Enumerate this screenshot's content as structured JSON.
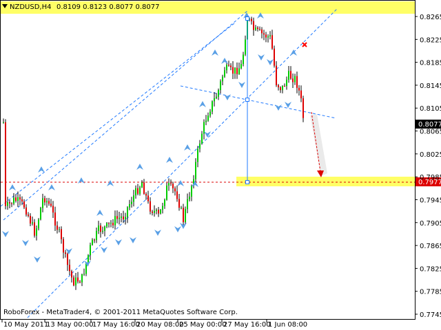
{
  "header": {
    "symbol": "NZDUSD,H4",
    "ohlc": "0.8109 0.8123 0.8077 0.8077"
  },
  "copyright": "RoboForex - MetaTrader4, © 2001-2011 MetaQuotes Software Corp.",
  "chart_data": {
    "type": "candlestick",
    "ylim": [
      0.7745,
      0.8285
    ],
    "grid": false,
    "y_ticks": [
      "0.8265",
      "0.8225",
      "0.8185",
      "0.8145",
      "0.8105",
      "0.8065",
      "0.8025",
      "0.7985",
      "0.7945",
      "0.7905",
      "0.7865",
      "0.7825",
      "0.7785",
      "0.7745"
    ],
    "x_ticks": [
      "10 May 2011",
      "13 May 00:00",
      "17 May 16:00",
      "20 May 08:00",
      "25 May 00:00",
      "27 May 16:00",
      "1 Jun 08:00"
    ],
    "price_labels": {
      "current": "0.8077",
      "target": "0.7977"
    },
    "current_price": 0.8077,
    "target_price": 0.7977,
    "colors": {
      "bull": "#00cc00",
      "bear": "#dd0000",
      "wick": "#000000",
      "channel": "#1e78ff",
      "fractal": "#5aa0e6",
      "target_line": "#dd0000",
      "highlight": "#ffff66",
      "cross": "#ff0000"
    },
    "icons": [
      "fractal-arrow-icon",
      "cross-icon",
      "forecast-arrow-icon"
    ]
  }
}
